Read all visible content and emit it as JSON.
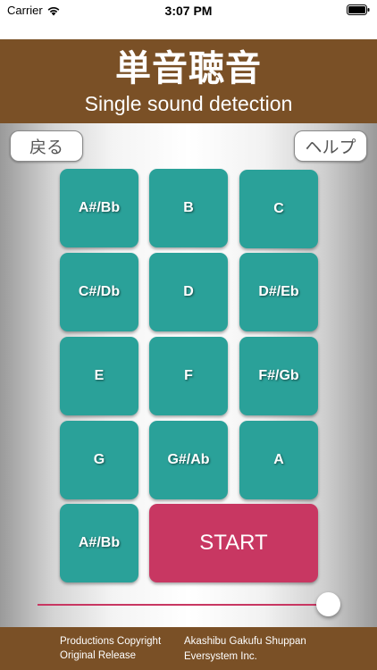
{
  "status_bar": {
    "carrier": "Carrier",
    "time": "3:07 PM",
    "icons": [
      "wifi-icon",
      "battery-icon"
    ]
  },
  "header": {
    "title_jp": "単音聴音",
    "title_en": "Single sound detection",
    "background_color": "#7a5026"
  },
  "nav": {
    "back_label": "戻る",
    "help_label": "ヘルプ"
  },
  "notes": [
    "A#/Bb",
    "B",
    "C",
    "C#/Db",
    "D",
    "D#/Eb",
    "E",
    "F",
    "F#/Gb",
    "G",
    "G#/Ab",
    "A",
    "A#/Bb"
  ],
  "start_label": "START",
  "colors": {
    "note_key": "#2aa199",
    "start": "#c83762",
    "slider": "#c83762"
  },
  "slider": {
    "value_fraction": 1.0
  },
  "footer": {
    "line1_left": "Productions Copyright",
    "line1_right": "Akashibu Gakufu Shuppan",
    "line2_left": "Original Release",
    "line2_right": "Eversystem Inc."
  }
}
